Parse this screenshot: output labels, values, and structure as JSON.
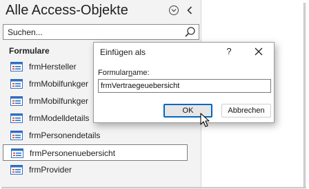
{
  "nav_pane": {
    "title": "Alle Access-Objekte",
    "search": {
      "placeholder": "Suchen...",
      "value": ""
    },
    "section_header": "Formulare",
    "items": [
      {
        "label": "frmHersteller",
        "icon": "form-icon",
        "selected": false
      },
      {
        "label": "frmMobilfunkger",
        "icon": "form-icon",
        "selected": false
      },
      {
        "label": "frmMobilfunkger",
        "icon": "form-icon",
        "selected": false
      },
      {
        "label": "frmModelldetails",
        "icon": "form-icon",
        "selected": false
      },
      {
        "label": "frmPersonendetails",
        "icon": "form-icon",
        "selected": false
      },
      {
        "label": "frmPersonenuebersicht",
        "icon": "form-icon",
        "selected": true
      },
      {
        "label": "frmProvider",
        "icon": "form-icon",
        "selected": false
      }
    ]
  },
  "dialog": {
    "title": "Einfügen als",
    "help": "?",
    "field_label_prefix": "Formular",
    "field_label_underlined": "n",
    "field_label_suffix": "ame:",
    "field_value": "frmVertraegeuebersicht",
    "ok_label": "OK",
    "cancel_label": "Abbrechen"
  },
  "colors": {
    "nav_background": "#f3f3f3",
    "accent": "#0067c0",
    "form_icon_blue": "#2e6fc1",
    "form_icon_red": "#c0392b"
  }
}
